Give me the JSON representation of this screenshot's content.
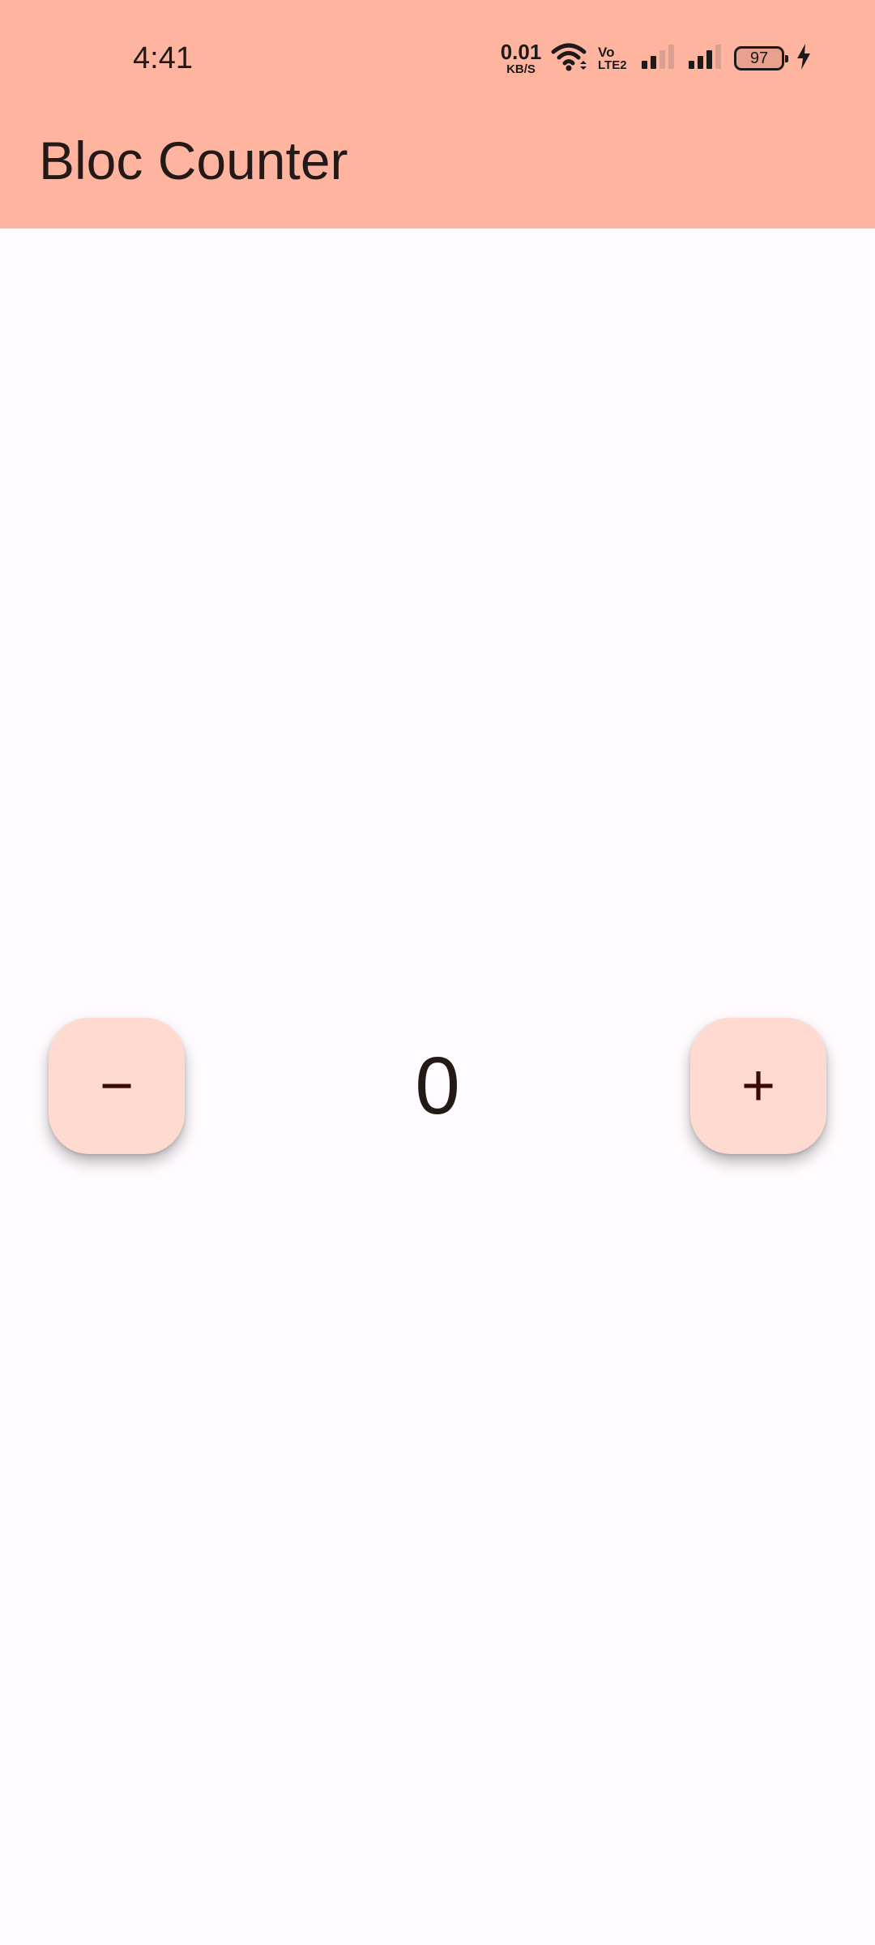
{
  "status_bar": {
    "time": "4:41",
    "net_speed_value": "0.01",
    "net_speed_unit": "KB/S",
    "volte_top": "Vo",
    "volte_bottom": "LTE2",
    "battery": "97"
  },
  "app_bar": {
    "title": "Bloc Counter"
  },
  "counter": {
    "value": "0",
    "decrement_label": "−",
    "increment_label": "+"
  },
  "colors": {
    "app_bar_background": "#FFB4A0",
    "page_background": "#FFFBFE",
    "fab_background": "#FFDAD1",
    "fab_icon": "#3A0B03"
  }
}
